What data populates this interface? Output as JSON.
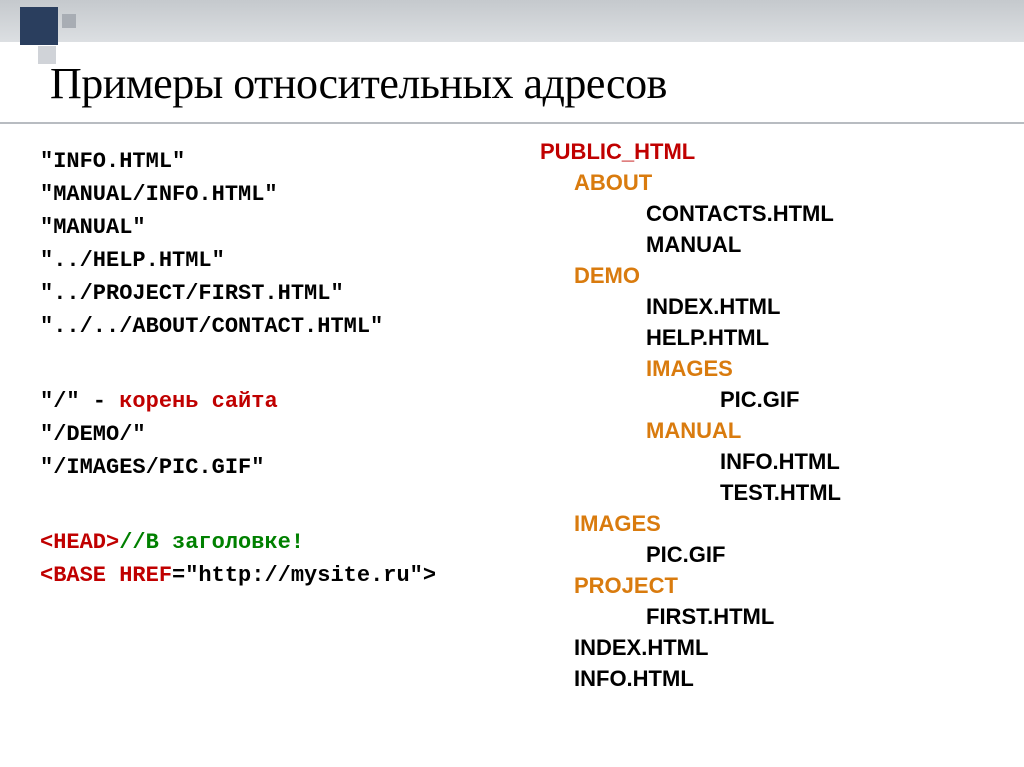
{
  "title": "Примеры относительных адресов",
  "leftLines": {
    "l1": "\"INFO.HTML\"",
    "l2": "\"MANUAL/INFO.HTML\"",
    "l3": "\"MANUAL\"",
    "l4": "\"../HELP.HTML\"",
    "l5": "\"../PROJECT/FIRST.HTML\"",
    "l6": "\"../../ABOUT/CONTACT.HTML\"",
    "root1a": "\"/\" - ",
    "root1b": "корень сайта",
    "root2": "\"/DEMO/\"",
    "root3": "\"/IMAGES/PIC.GIF\"",
    "head1a": "<HEAD>",
    "head1b": "//В заголовке!",
    "head2a": "<BASE HREF",
    "head2b": "=\"http://mysite.ru\">"
  },
  "tree": {
    "root": "PUBLIC_HTML",
    "about": "ABOUT",
    "contacts": "CONTACTS.HTML",
    "manual1": "MANUAL",
    "demo": "DEMO",
    "index": "INDEX.HTML",
    "help": "HELP.HTML",
    "images1": "IMAGES",
    "pic1": "PIC.GIF",
    "manual2": "MANUAL",
    "info1": "INFO.HTML",
    "test": "TEST.HTML",
    "images2": "IMAGES",
    "pic2": "PIC.GIF",
    "project": "PROJECT",
    "first": "FIRST.HTML",
    "index2": "INDEX.HTML",
    "info2": "INFO.HTML"
  }
}
